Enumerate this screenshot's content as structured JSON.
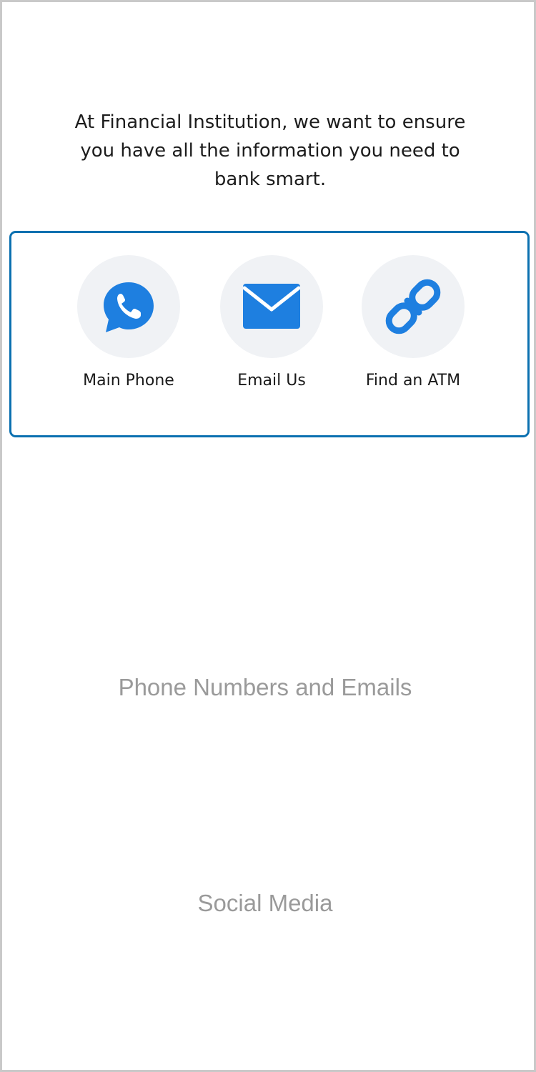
{
  "intro": {
    "text": "At Financial Institution, we want to ensure you have all the information you need to bank smart."
  },
  "quick_actions": [
    {
      "label": "Main Phone",
      "icon": "whatsapp-phone-icon"
    },
    {
      "label": "Email Us",
      "icon": "envelope-icon"
    },
    {
      "label": "Find an ATM",
      "icon": "link-icon"
    }
  ],
  "sections": {
    "phone_emails": "Phone Numbers and Emails",
    "social_media": "Social Media"
  },
  "colors": {
    "accent": "#1e7fe0",
    "panel_border": "#0b70b0",
    "icon_bg": "#f0f2f5",
    "section_text": "#9a9a9a"
  }
}
